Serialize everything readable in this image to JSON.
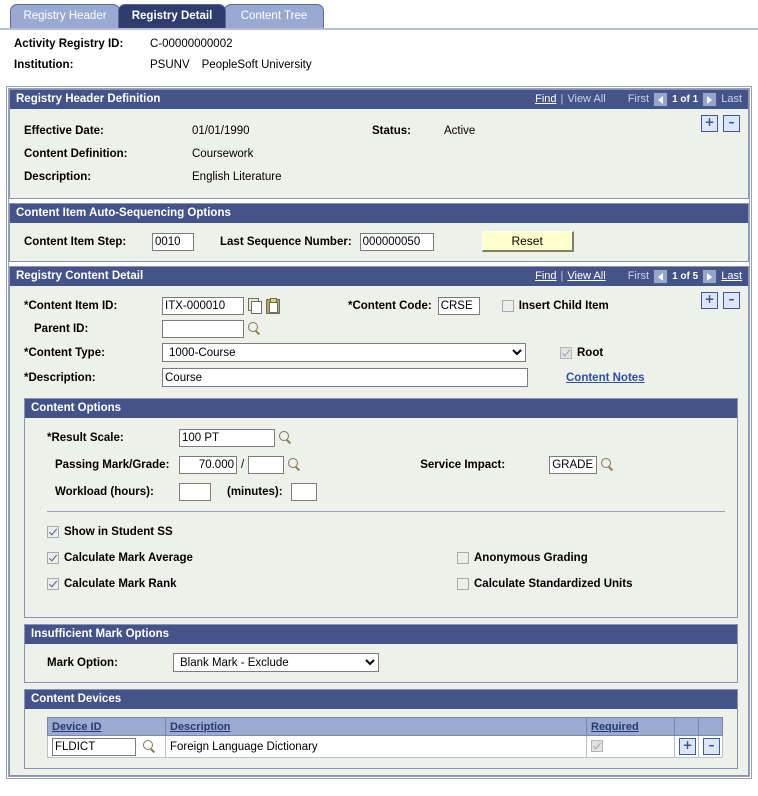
{
  "tabs": [
    {
      "label": "Registry Header",
      "active": false
    },
    {
      "label": "Registry Detail",
      "active": true
    },
    {
      "label": "Content Tree",
      "active": false
    }
  ],
  "keyfields": {
    "activity_registry_id_label": "Activity Registry ID:",
    "activity_registry_id_value": "C-00000000002",
    "institution_label": "Institution:",
    "institution_code": "PSUNV",
    "institution_name": "PeopleSoft University"
  },
  "registry_header_definition": {
    "title": "Registry Header Definition",
    "nav": {
      "find": "Find",
      "separator": "|",
      "view_all": "View All",
      "first": "First",
      "count": "1 of 1",
      "last": "Last"
    },
    "effective_date_label": "Effective Date:",
    "effective_date_value": "01/01/1990",
    "status_label": "Status:",
    "status_value": "Active",
    "content_definition_label": "Content Definition:",
    "content_definition_value": "Coursework",
    "description_label": "Description:",
    "description_value": "English Literature",
    "add_row": "+",
    "delete_row": "–"
  },
  "auto_sequencing": {
    "title": "Content Item Auto-Sequencing Options",
    "content_item_step_label": "Content Item Step:",
    "content_item_step_value": "0010",
    "last_sequence_number_label": "Last Sequence Number:",
    "last_sequence_number_value": "000000050",
    "reset_button": "Reset"
  },
  "registry_content_detail": {
    "title": "Registry Content Detail",
    "nav": {
      "find": "Find",
      "separator": "|",
      "view_all": "View All",
      "first": "First",
      "count": "1 of 5",
      "last": "Last"
    },
    "content_item_id_label": "*Content Item ID:",
    "content_item_id_value": "ITX-000010",
    "copy_icon": "copy-icon",
    "paste_icon": "paste-icon",
    "content_code_label": "*Content Code:",
    "content_code_value": "CRSE",
    "insert_child_item_label": "Insert Child Item",
    "insert_child_item_checked": false,
    "parent_id_label": "Parent ID:",
    "parent_id_value": "",
    "content_type_label": "*Content Type:",
    "content_type_value": "1000-Course",
    "root_label": "Root",
    "root_checked": true,
    "description_label": "*Description:",
    "description_value": "Course",
    "content_notes_link": "Content Notes",
    "add_row": "+",
    "delete_row": "–"
  },
  "content_options": {
    "title": "Content Options",
    "result_scale_label": "*Result Scale:",
    "result_scale_value": "100 PT",
    "passing_mark_label": "Passing Mark/Grade:",
    "passing_mark_value": "70.000",
    "passing_mark_separator": "/",
    "passing_grade_value": "",
    "service_impact_label": "Service Impact:",
    "service_impact_value": "GRADE",
    "workload_hours_label": "Workload (hours):",
    "workload_hours_value": "",
    "workload_minutes_label": "(minutes):",
    "workload_minutes_value": "",
    "checkboxes_left": [
      {
        "label": "Show in Student SS",
        "checked": true
      },
      {
        "label": "Calculate Mark Average",
        "checked": true
      },
      {
        "label": "Calculate Mark Rank",
        "checked": true
      }
    ],
    "checkboxes_right": [
      {
        "label": "Anonymous Grading",
        "checked": false
      },
      {
        "label": "Calculate Standardized Units",
        "checked": false
      }
    ]
  },
  "insufficient_mark_options": {
    "title": "Insufficient Mark Options",
    "mark_option_label": "Mark Option:",
    "mark_option_value": "Blank Mark - Exclude"
  },
  "content_devices": {
    "title": "Content Devices",
    "columns": [
      "Device ID",
      "Description",
      "Required",
      "",
      ""
    ],
    "rows": [
      {
        "device_id": "FLDICT",
        "description": "Foreign Language Dictionary",
        "required_checked": true,
        "add_row": "+",
        "delete_row": "–"
      }
    ]
  },
  "colors": {
    "group_header_bg": "#44538a",
    "active_tab_bg": "#2e3c6e",
    "inactive_tab_bg": "#98aad2",
    "panel_bg": "#eef0ea",
    "grid_header_bg": "#9aaad0",
    "button_bg": "#ffffcc",
    "link": "#2f4fae"
  }
}
